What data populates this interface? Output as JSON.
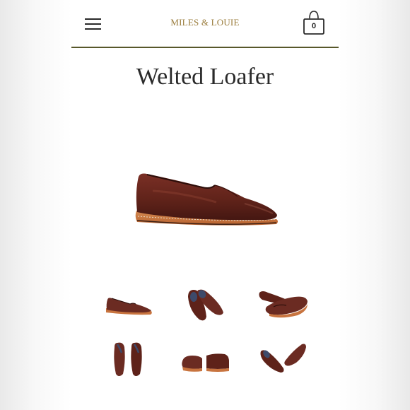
{
  "header": {
    "logo_text": "MILES & LOUIE",
    "cart_count": "0",
    "menu_icon": "hamburger-menu-icon",
    "cart_icon": "shopping-bag-icon"
  },
  "product": {
    "title": "Welted Loafer"
  },
  "colors": {
    "accent_rule": "#57572a",
    "logo": "#9a7c3c",
    "leather": "#6b2b22",
    "sole": "#c8743f"
  }
}
